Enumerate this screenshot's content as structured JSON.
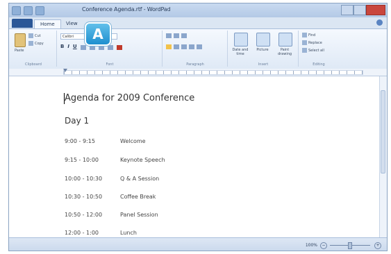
{
  "window": {
    "title": "Conference Agenda.rtf - WordPad"
  },
  "tabs": [
    {
      "label": "Home"
    },
    {
      "label": "View"
    }
  ],
  "ribbon": {
    "clipboard": {
      "paste_label": "Paste",
      "cut_label": "Cut",
      "copy_label": "Copy",
      "group_label": "Clipboard"
    },
    "font": {
      "family_value": "Calibri",
      "size_value": "20",
      "bold": "B",
      "italic": "I",
      "underline": "U",
      "group_label": "Font"
    },
    "paragraph": {
      "group_label": "Paragraph"
    },
    "insert": {
      "datetime_label": "Date and time",
      "picture_label": "Picture",
      "paint_label": "Paint drawing",
      "group_label": "Insert"
    },
    "editing": {
      "find_label": "Find",
      "replace_label": "Replace",
      "selectall_label": "Select all",
      "group_label": "Editing"
    }
  },
  "callout": {
    "label": "A"
  },
  "document": {
    "title": "Agenda for 2009 Conference",
    "day": "Day 1",
    "rows": [
      {
        "time": "9:00 - 9:15",
        "event": "Welcome"
      },
      {
        "time": "9:15 - 10:00",
        "event": "Keynote Speech"
      },
      {
        "time": "10:00 - 10:30",
        "event": "Q & A Session"
      },
      {
        "time": "10:30 - 10:50",
        "event": "Coffee Break"
      },
      {
        "time": "10:50 - 12:00",
        "event": "Panel Session"
      },
      {
        "time": "12:00 - 1:00",
        "event": "Lunch"
      }
    ]
  },
  "status": {
    "zoom": "100%"
  },
  "colors": {
    "accent": "#2b5797",
    "callout": "#1e8fcf"
  }
}
